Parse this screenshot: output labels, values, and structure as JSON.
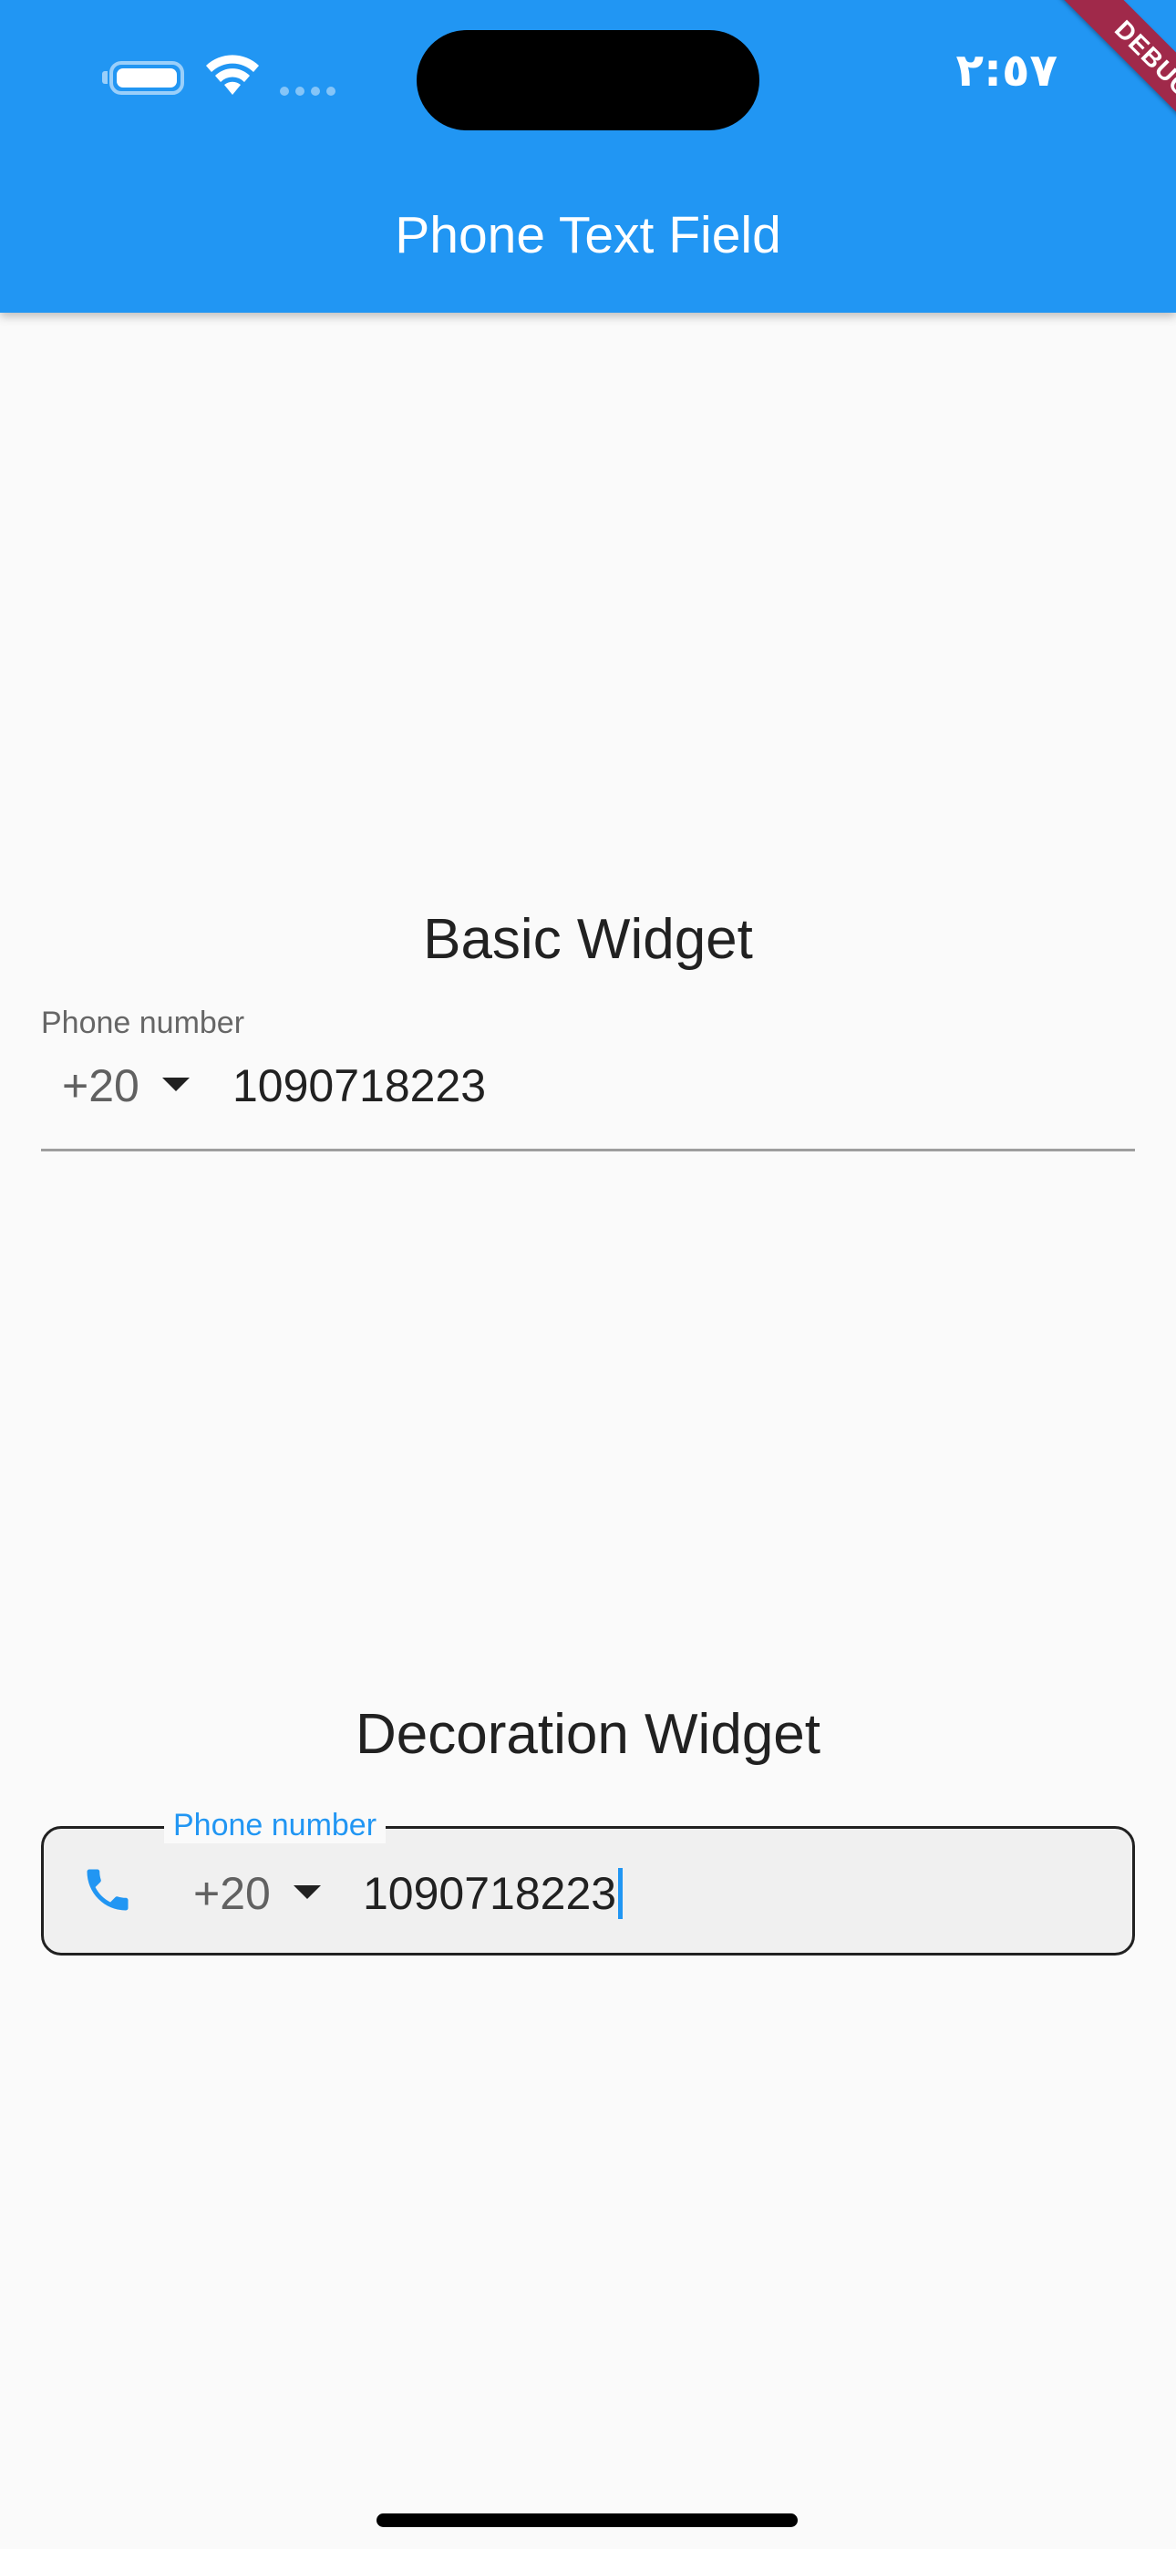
{
  "status_bar": {
    "time": "٢:٥٧",
    "battery_icon": "battery-icon",
    "wifi_icon": "wifi-icon"
  },
  "app_bar": {
    "title": "Phone Text Field"
  },
  "debug_banner": {
    "label": "DEBUG"
  },
  "basic_widget": {
    "heading": "Basic Widget",
    "field_label": "Phone number",
    "country_code": "+20",
    "phone_value": "1090718223"
  },
  "decoration_widget": {
    "heading": "Decoration Widget",
    "field_label": "Phone number",
    "prefix_icon": "phone-icon",
    "country_code": "+20",
    "phone_value": "1090718223"
  },
  "colors": {
    "primary": "#2196f3",
    "debug_banner": "#a0294a",
    "background": "#fafafa"
  }
}
